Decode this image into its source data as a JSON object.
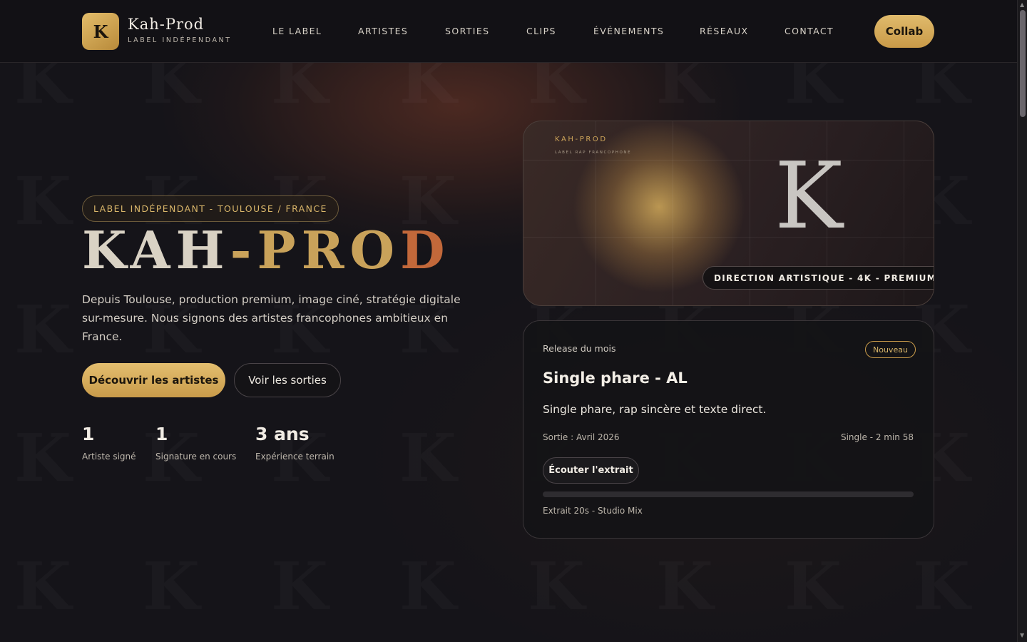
{
  "header": {
    "logo_letter": "K",
    "brand_name": "Kah-Prod",
    "brand_sub": "LABEL INDÉPENDANT",
    "nav": [
      "LE LABEL",
      "ARTISTES",
      "SORTIES",
      "CLIPS",
      "ÉVÉNEMENTS",
      "RÉSEAUX",
      "CONTACT"
    ],
    "cta": "Collab"
  },
  "hero": {
    "tag": "LABEL INDÉPENDANT - TOULOUSE / FRANCE",
    "title_part1": "KAH",
    "title_dash": "-",
    "title_part2": "PRO",
    "title_part3": "D",
    "description": "Depuis Toulouse, production premium, image ciné, stratégie digitale sur-mesure. Nous signons des artistes francophones ambitieux en France.",
    "primary_button": "Découvrir les artistes",
    "secondary_button": "Voir les sorties",
    "stats": [
      {
        "value": "1",
        "label": "Artiste signé"
      },
      {
        "value": "1",
        "label": "Signature en cours"
      },
      {
        "value": "3 ans",
        "label": "Expérience terrain"
      }
    ]
  },
  "art_card": {
    "brand": "KAH-PROD",
    "sub": "LABEL RAP FRANCOPHONE",
    "letter": "K",
    "pill": "DIRECTION ARTISTIQUE - 4K - PREMIUM"
  },
  "release": {
    "label": "Release du mois",
    "badge": "Nouveau",
    "title": "Single phare - AL",
    "description": "Single phare, rap sincère et texte direct.",
    "date": "Sortie : Avril 2026",
    "meta": "Single - 2 min 58",
    "button": "Écouter l'extrait",
    "progress": 0,
    "footer": "Extrait 20s - Studio Mix"
  },
  "colors": {
    "background": "#141318",
    "gold": "#c99b4a",
    "copper": "#c2683a"
  },
  "icons": {
    "scroll_up": "triangle-up",
    "scroll_down": "triangle-down"
  }
}
